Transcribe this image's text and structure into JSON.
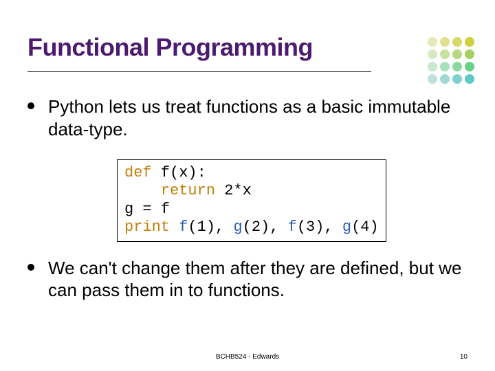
{
  "title": "Functional Programming",
  "bullets": [
    "Python lets us treat functions as a basic immutable data-type.",
    "We can't change them after they are defined, but we can pass them in to functions."
  ],
  "code": {
    "l1a": "def",
    "l1b": " f(x):",
    "l2": "    ",
    "l2a": "return",
    "l2b": " 2*x",
    "l3": "g = f",
    "l4a": "print",
    "l4b": " ",
    "l4c": "f",
    "l4d": "(1), ",
    "l4e": "g",
    "l4f": "(2), ",
    "l4g": "f",
    "l4h": "(3), ",
    "l4i": "g",
    "l4j": "(4)"
  },
  "footer": {
    "center": "BCHB524 - Edwards",
    "page": "10"
  },
  "dot_colors": [
    "#e8e8b8",
    "#e0e090",
    "#d8d868",
    "#d0d040",
    "#d8e8c0",
    "#c8e0a0",
    "#b8d880",
    "#a8d060",
    "#c8e8d0",
    "#a8e0b8",
    "#88d8a0",
    "#68d088",
    "#c0e0e0",
    "#a0d8d8",
    "#80d0d0",
    "#60c8c8"
  ]
}
